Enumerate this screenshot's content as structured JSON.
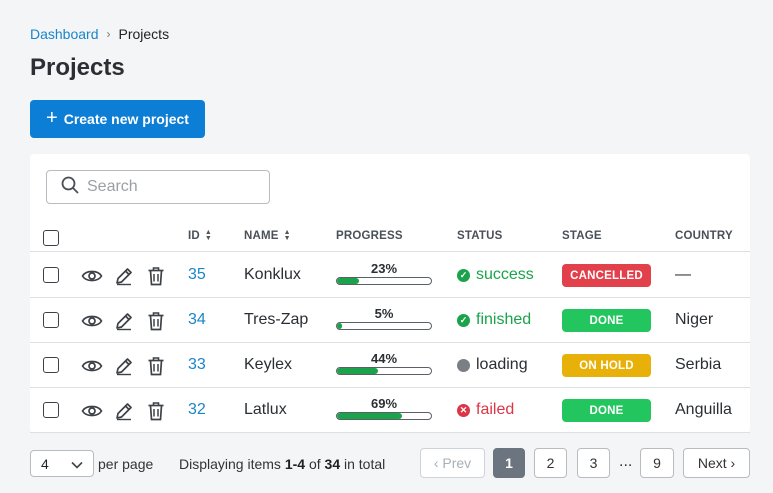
{
  "breadcrumb": {
    "home": "Dashboard",
    "separator": "›",
    "current": "Projects"
  },
  "page_title": "Projects",
  "create_button": {
    "label": "Create new project"
  },
  "search": {
    "placeholder": "Search",
    "value": ""
  },
  "table": {
    "headers": {
      "id": "ID",
      "name": "NAME",
      "progress": "PROGRESS",
      "status": "STATUS",
      "stage": "STAGE",
      "country": "COUNTRY"
    },
    "rows": [
      {
        "id": "35",
        "name": "Konklux",
        "progress": 23,
        "progress_label": "23%",
        "status": "success",
        "stage": "CANCELLED",
        "country": "—"
      },
      {
        "id": "34",
        "name": "Tres-Zap",
        "progress": 5,
        "progress_label": "5%",
        "status": "finished",
        "stage": "DONE",
        "country": "Niger"
      },
      {
        "id": "33",
        "name": "Keylex",
        "progress": 44,
        "progress_label": "44%",
        "status": "loading",
        "stage": "ON HOLD",
        "country": "Serbia"
      },
      {
        "id": "32",
        "name": "Latlux",
        "progress": 69,
        "progress_label": "69%",
        "status": "failed",
        "stage": "DONE",
        "country": "Anguilla"
      }
    ]
  },
  "colors": {
    "accent": "#0d7ed6",
    "link": "#1a86c8",
    "success": "#1aa34a",
    "failed": "#dc3545",
    "loading": "#7a7f85",
    "stage_cancelled": "#e2404a",
    "stage_done": "#22c55e",
    "stage_on_hold": "#e8b10a"
  },
  "footer": {
    "per_page_value": "4",
    "per_page_label": "per page",
    "displaying_prefix": "Displaying items",
    "displaying_range": "1-4",
    "displaying_of": "of",
    "displaying_total": "34",
    "displaying_suffix": "in total",
    "prev": "‹ Prev",
    "next": "Next ›",
    "pages": [
      "1",
      "2",
      "3",
      "9"
    ],
    "ellipsis": "...",
    "active_page": "1"
  }
}
